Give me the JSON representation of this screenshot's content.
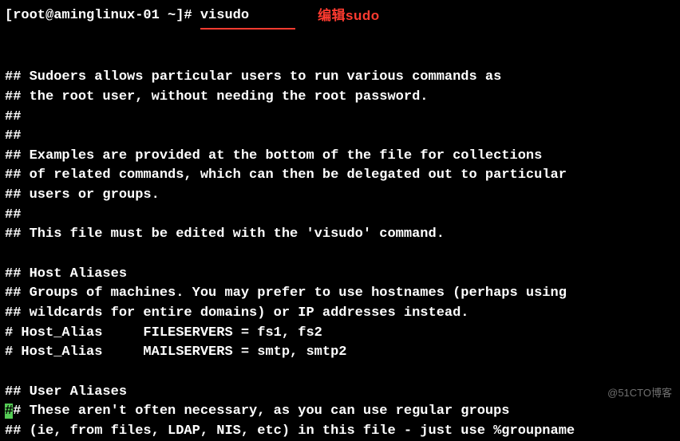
{
  "prompt": "[root@aminglinux-01 ~]# ",
  "command": "visudo",
  "annotation": "编辑sudo",
  "lines": {
    "l0": "## Sudoers allows particular users to run various commands as",
    "l1": "## the root user, without needing the root password.",
    "l2": "##",
    "l3": "##",
    "l4": "## Examples are provided at the bottom of the file for collections",
    "l5": "## of related commands, which can then be delegated out to particular",
    "l6": "## users or groups.",
    "l7": "##",
    "l8": "## This file must be edited with the 'visudo' command.",
    "l9": "",
    "l10": "## Host Aliases",
    "l11": "## Groups of machines. You may prefer to use hostnames (perhaps using",
    "l12": "## wildcards for entire domains) or IP addresses instead.",
    "l13": "# Host_Alias     FILESERVERS = fs1, fs2",
    "l14": "# Host_Alias     MAILSERVERS = smtp, smtp2",
    "l15": "",
    "l16": "## User Aliases",
    "l17a": "#",
    "l17b": "# These aren't often necessary, as you can use regular groups",
    "l18": "## (ie, from files, LDAP, NIS, etc) in this file - just use %groupname"
  },
  "watermark": "@51CTO博客"
}
